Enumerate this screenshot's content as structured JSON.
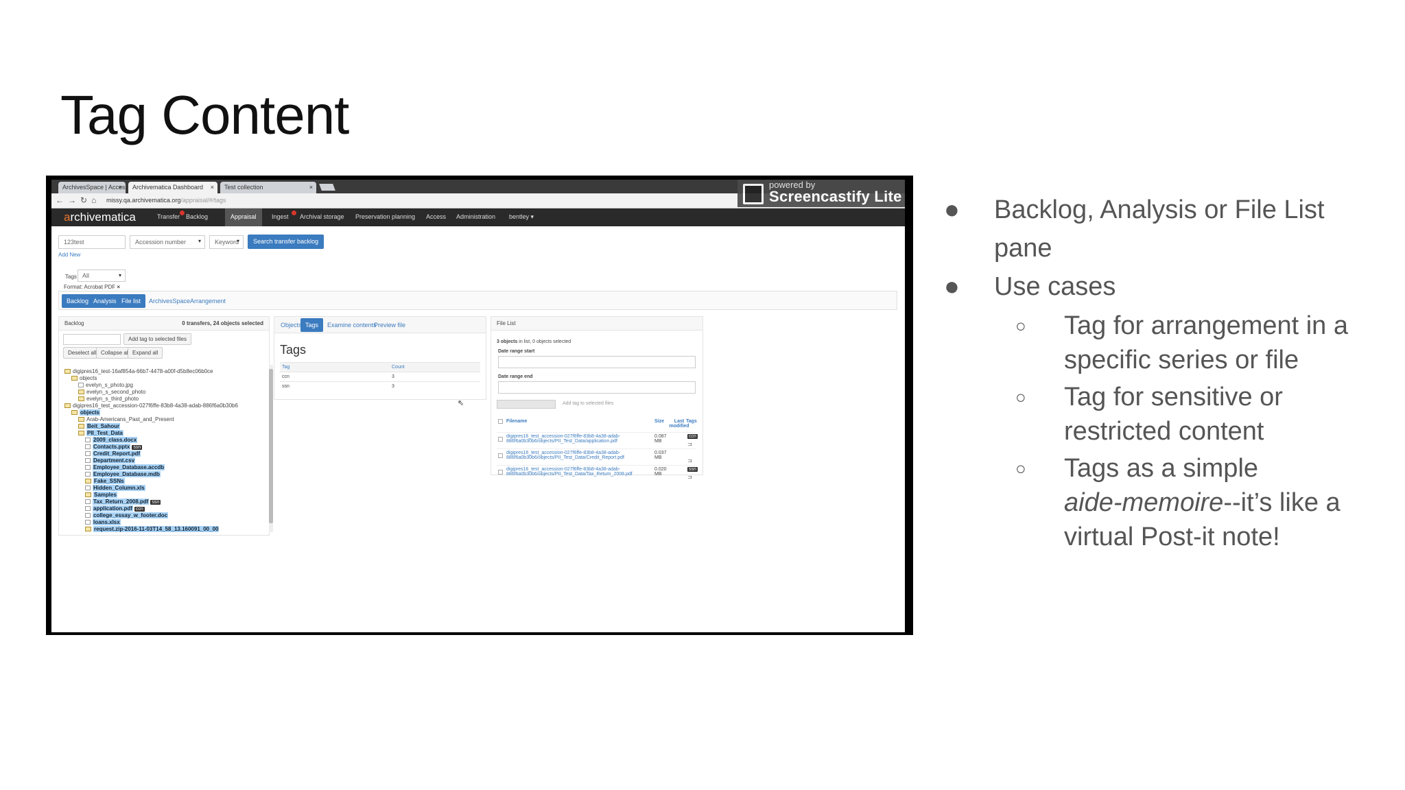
{
  "slide": {
    "title": "Tag Content",
    "bullets": [
      {
        "lines": [
          "Backlog, Analysis or File List",
          "pane"
        ]
      },
      {
        "lines": [
          "Use cases"
        ],
        "sub": [
          {
            "lines": [
              "Tag for arrangement in a",
              "specific series or file"
            ]
          },
          {
            "lines": [
              "Tag for sensitive or",
              "restricted content"
            ]
          },
          {
            "lines_html_parts": [
              "Tags as a simple",
              "aide-memoire",
              "--it’s like a",
              "virtual Post-it note!"
            ]
          }
        ]
      }
    ]
  },
  "browser": {
    "tabs": [
      "ArchivesSpace | Access...",
      "Archivematica Dashboard",
      "Test collection"
    ],
    "url_host": "missy.qa.archivematica.org",
    "url_path": "/appraisal/#/tags"
  },
  "overlay": {
    "powered": "powered by",
    "name": "Screencastify Lite"
  },
  "app": {
    "brand": "rchivematica",
    "brand_letter": "a",
    "nav": [
      "Transfer",
      "Backlog",
      "Appraisal",
      "Ingest",
      "Archival storage",
      "Preservation planning",
      "Access",
      "Administration",
      "bentley"
    ],
    "search": {
      "query": "123test",
      "field": "Accession number",
      "type": "Keyword",
      "button": "Search transfer backlog",
      "add_new": "Add New"
    },
    "filters": {
      "tags_label": "Tags",
      "tags_value": "All",
      "format": "Format: Acrobat PDF"
    },
    "pane_tabs": [
      "Backlog",
      "Analysis",
      "File list",
      "ArchivesSpace",
      "Arrangement"
    ],
    "backlog": {
      "title": "Backlog",
      "summary": "0 transfers, 24 objects selected",
      "add_tag": "Add tag to selected files",
      "buttons": [
        "Deselect all",
        "Collapse all",
        "Expand all"
      ]
    },
    "tree": [
      {
        "t": "digipres16_test-16af854a-66b7-4478-a00f-d5b8ec06b0ce",
        "lvl": 0,
        "k": "fo",
        "hl": false
      },
      {
        "t": "objects",
        "lvl": 1,
        "k": "fo",
        "hl": false
      },
      {
        "t": "evelyn_s_photo.jpg",
        "lvl": 2,
        "k": "fi",
        "hl": false
      },
      {
        "t": "evelyn_s_second_photo",
        "lvl": 2,
        "k": "fo",
        "hl": false
      },
      {
        "t": "evelyn_s_third_photo",
        "lvl": 2,
        "k": "fo",
        "hl": false
      },
      {
        "t": "digipres16_test_accession-027f6ffe-83b8-4a38-adab-886f6a0b30b6",
        "lvl": 0,
        "k": "fo",
        "hl": false
      },
      {
        "t": "objects",
        "lvl": 1,
        "k": "fo",
        "hl": true
      },
      {
        "t": "Arab-Americans_Past_and_Present",
        "lvl": 2,
        "k": "fo",
        "hl": false
      },
      {
        "t": "Beit_Sahour",
        "lvl": 2,
        "k": "fo",
        "hl": true
      },
      {
        "t": "PII_Test_Data",
        "lvl": 2,
        "k": "fo",
        "hl": true
      },
      {
        "t": "2009_class.docx",
        "lvl": 3,
        "k": "fi",
        "hl": true
      },
      {
        "t": "Contacts.pptx",
        "lvl": 3,
        "k": "fi",
        "hl": true,
        "tag": "ssn"
      },
      {
        "t": "Credit_Report.pdf",
        "lvl": 3,
        "k": "fi",
        "hl": true
      },
      {
        "t": "Department.csv",
        "lvl": 3,
        "k": "fi",
        "hl": true
      },
      {
        "t": "Employee_Database.accdb",
        "lvl": 3,
        "k": "fi",
        "hl": true
      },
      {
        "t": "Employee_Database.mdb",
        "lvl": 3,
        "k": "fi",
        "hl": true
      },
      {
        "t": "Fake_SSNs",
        "lvl": 3,
        "k": "fo",
        "hl": true
      },
      {
        "t": "Hidden_Column.xls",
        "lvl": 3,
        "k": "fi",
        "hl": true
      },
      {
        "t": "Samples",
        "lvl": 3,
        "k": "fo",
        "hl": true
      },
      {
        "t": "Tax_Return_2008.pdf",
        "lvl": 3,
        "k": "fi",
        "hl": true,
        "tag": "ssn"
      },
      {
        "t": "application.pdf",
        "lvl": 3,
        "k": "fi",
        "hl": true,
        "tag": "ccn"
      },
      {
        "t": "college_essay_w_footer.doc",
        "lvl": 3,
        "k": "fi",
        "hl": true
      },
      {
        "t": "loans.xlsx",
        "lvl": 3,
        "k": "fi",
        "hl": true
      },
      {
        "t": "request.zip-2016-11-03T14_58_13.160091_00_00",
        "lvl": 3,
        "k": "fo",
        "hl": true
      }
    ],
    "analysis": {
      "tabs": [
        "Objects",
        "Tags",
        "Examine contents",
        "Preview file"
      ],
      "heading": "Tags",
      "cols": [
        "Tag",
        "Count"
      ],
      "rows": [
        [
          "ccn",
          "3"
        ],
        [
          "ssn",
          "3"
        ]
      ]
    },
    "filelist": {
      "title": "File List",
      "count_bold": "3 objects",
      "count_rest": " in list, 0 objects selected",
      "date_start": "Date range start",
      "date_end": "Date range end",
      "add_tag": "Add tag to selected files",
      "cols": [
        "Filename",
        "Size",
        "Last modified",
        "Tags"
      ],
      "rows": [
        {
          "name1": "digipres16_test_accession-027f6ffe-83b8-4a38-adab-",
          "name2": "886f6a0b30b6/objects/PII_Test_Data/application.pdf",
          "size1": "0.087",
          "size2": "MB",
          "tag": "ccn"
        },
        {
          "name1": "digipres16_test_accession-027f6ffe-83b8-4a38-adab-",
          "name2": "886f6a0b30b6/objects/PII_Test_Data/Credit_Report.pdf",
          "size1": "0.037",
          "size2": "MB",
          "tag": ""
        },
        {
          "name1": "digipres16_test_accession-027f6ffe-83b8-4a38-adab-",
          "name2": "886f6a0b30b6/objects/PII_Test_Data/Tax_Return_2008.pdf",
          "size1": "0.020",
          "size2": "MB",
          "tag": "ssn"
        }
      ]
    }
  },
  "colors": {
    "accent": "#3b7bbf",
    "nav": "#2a2a2a",
    "highlight": "#a9d3f5",
    "brand_o": "#e8772e"
  }
}
